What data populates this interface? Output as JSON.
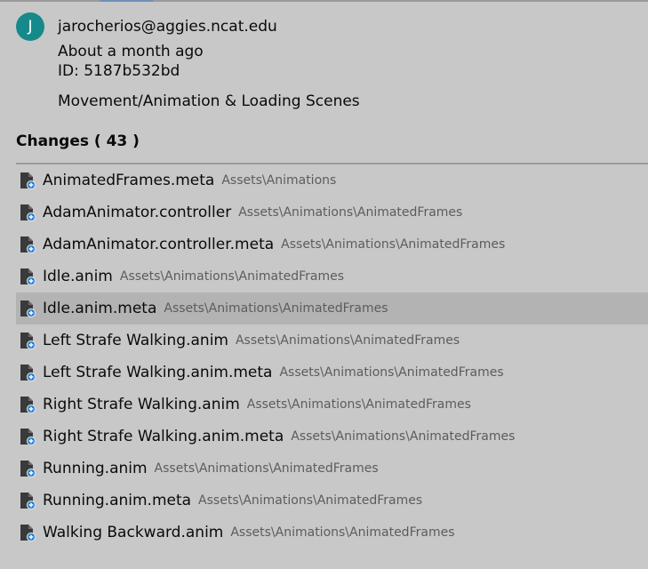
{
  "commit": {
    "avatar_initial": "J",
    "author": "jarocherios@aggies.ncat.edu",
    "date": "About a month ago",
    "id_line": "ID: 5187b532bd",
    "message": "Movement/Animation & Loading Scenes"
  },
  "changes": {
    "header": "Changes ( 43 )",
    "icon": "added-file-icon",
    "items": [
      {
        "name": "AnimatedFrames.meta",
        "path": "Assets\\Animations"
      },
      {
        "name": "AdamAnimator.controller",
        "path": "Assets\\Animations\\AnimatedFrames"
      },
      {
        "name": "AdamAnimator.controller.meta",
        "path": "Assets\\Animations\\AnimatedFrames"
      },
      {
        "name": "Idle.anim",
        "path": "Assets\\Animations\\AnimatedFrames"
      },
      {
        "name": "Idle.anim.meta",
        "path": "Assets\\Animations\\AnimatedFrames"
      },
      {
        "name": "Left Strafe Walking.anim",
        "path": "Assets\\Animations\\AnimatedFrames"
      },
      {
        "name": "Left Strafe Walking.anim.meta",
        "path": "Assets\\Animations\\AnimatedFrames"
      },
      {
        "name": "Right Strafe Walking.anim",
        "path": "Assets\\Animations\\AnimatedFrames"
      },
      {
        "name": "Right Strafe Walking.anim.meta",
        "path": "Assets\\Animations\\AnimatedFrames"
      },
      {
        "name": "Running.anim",
        "path": "Assets\\Animations\\AnimatedFrames"
      },
      {
        "name": "Running.anim.meta",
        "path": "Assets\\Animations\\AnimatedFrames"
      },
      {
        "name": "Walking Backward.anim",
        "path": "Assets\\Animations\\AnimatedFrames"
      }
    ]
  },
  "colors": {
    "background": "#c8c8c8",
    "selected_row": "#b3b3b3",
    "avatar": "#168a8a",
    "add_badge": "#2f7fd8"
  }
}
